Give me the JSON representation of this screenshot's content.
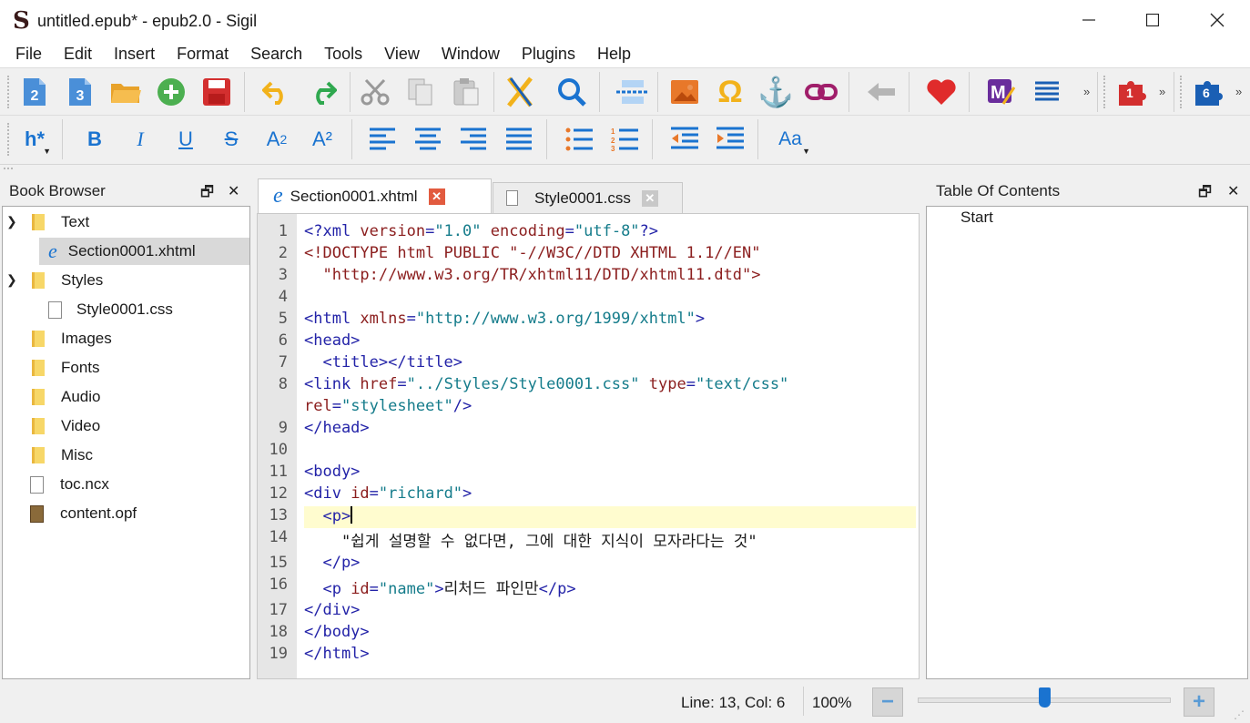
{
  "window": {
    "title": "untitled.epub* - epub2.0 - Sigil",
    "logo": "S"
  },
  "menu": [
    "File",
    "Edit",
    "Insert",
    "Format",
    "Search",
    "Tools",
    "View",
    "Window",
    "Plugins",
    "Help"
  ],
  "toolbar": {
    "new_epub2": "2",
    "new_epub3": "3",
    "plugin1_badge": "1",
    "plugin6_badge": "6",
    "heading_label": "h*",
    "bold": "B",
    "italic": "I",
    "underline": "U",
    "strike": "S",
    "subscript": "A",
    "subscript_mark": "2",
    "superscript": "A²",
    "case_label": "Aa"
  },
  "book_browser": {
    "title": "Book Browser",
    "items": [
      {
        "label": "Text",
        "kind": "folder",
        "expanded": true
      },
      {
        "label": "Section0001.xhtml",
        "kind": "xhtml",
        "selected": true
      },
      {
        "label": "Styles",
        "kind": "folder",
        "expanded": true
      },
      {
        "label": "Style0001.css",
        "kind": "css"
      },
      {
        "label": "Images",
        "kind": "folder"
      },
      {
        "label": "Fonts",
        "kind": "folder"
      },
      {
        "label": "Audio",
        "kind": "folder"
      },
      {
        "label": "Video",
        "kind": "folder"
      },
      {
        "label": "Misc",
        "kind": "folder"
      },
      {
        "label": "toc.ncx",
        "kind": "file"
      },
      {
        "label": "content.opf",
        "kind": "opf"
      }
    ]
  },
  "tabs": [
    {
      "label": "Section0001.xhtml",
      "active": true
    },
    {
      "label": "Style0001.css",
      "active": false
    }
  ],
  "editor": {
    "line_numbers": [
      "1",
      "2",
      "3",
      "4",
      "5",
      "6",
      "7",
      "8",
      "9",
      "10",
      "11",
      "12",
      "13",
      "14",
      "15",
      "16",
      "17",
      "18",
      "19"
    ],
    "lines": {
      "l1a": "<?xml ",
      "l1b": "version",
      "l1c": "=",
      "l1d": "\"1.0\"",
      "l1e": " encoding",
      "l1f": "=",
      "l1g": "\"utf-8\"",
      "l1h": "?>",
      "l2": "<!DOCTYPE html PUBLIC \"-//W3C//DTD XHTML 1.1//EN\"",
      "l3": "  \"http://www.w3.org/TR/xhtml11/DTD/xhtml11.dtd\">",
      "l5a": "<html ",
      "l5b": "xmlns",
      "l5c": "=",
      "l5d": "\"http://www.w3.org/1999/xhtml\"",
      "l5e": ">",
      "l6": "<head>",
      "l7": "  <title></title>",
      "l8a": "<link ",
      "l8b": "href",
      "l8c": "=",
      "l8d": "\"../Styles/Style0001.css\"",
      "l8e": " type",
      "l8f": "=",
      "l8g": "\"text/css\"",
      "l8h": "rel",
      "l8i": "=",
      "l8j": "\"stylesheet\"",
      "l8k": "/>",
      "l9": "</head>",
      "l11": "<body>",
      "l12a": "<div ",
      "l12b": "id",
      "l12c": "=",
      "l12d": "\"richard\"",
      "l12e": ">",
      "l13": "  <p>",
      "l14": "    \"쉽게 설명할 수 없다면, 그에 대한 지식이 모자라다는 것\"",
      "l15": "  </p>",
      "l16a": "  <p ",
      "l16b": "id",
      "l16c": "=",
      "l16d": "\"name\"",
      "l16e": ">",
      "l16f": "리처드 파인만",
      "l16g": "</p>",
      "l17": "</div>",
      "l18": "</body>",
      "l19": "</html>"
    }
  },
  "toc": {
    "title": "Table Of Contents",
    "items": [
      "Start"
    ]
  },
  "status": {
    "position": "Line: 13, Col: 6",
    "zoom": "100%",
    "zoom_slider_fraction": 0.5,
    "minus": "−",
    "plus": "+"
  },
  "colors": {
    "tag": "#2323a8",
    "attr": "#8b1e1e",
    "value": "#157c8b",
    "current_line": "#fffccf",
    "accent": "#1a73d0"
  }
}
